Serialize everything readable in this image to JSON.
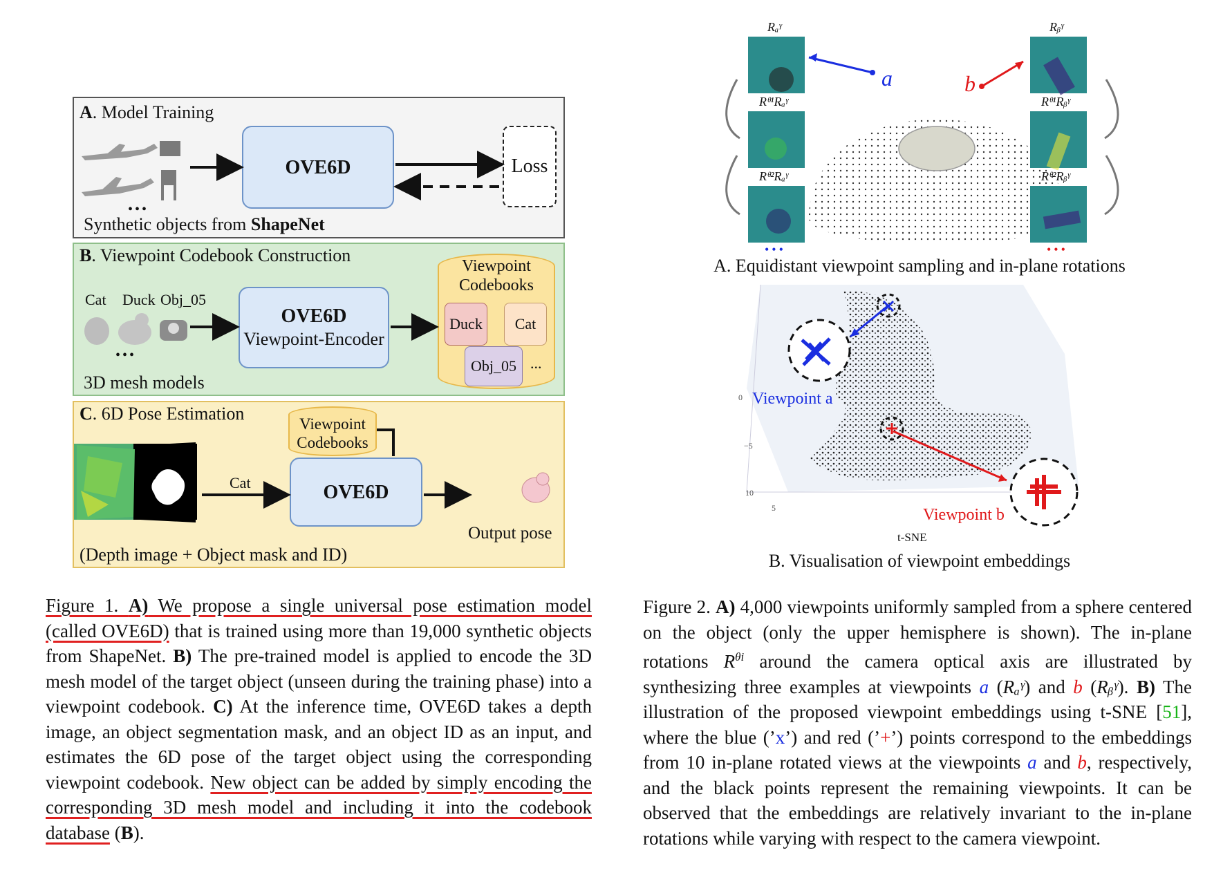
{
  "fig1": {
    "panel_a": {
      "title_letter": "A",
      "title_rest": ". Model Training",
      "model": "OVE6D",
      "loss": "Loss",
      "dots": "•••",
      "source_prefix": "Synthetic objects from ",
      "source_bold": "ShapeNet"
    },
    "panel_b": {
      "title_letter": "B",
      "title_rest": ". Viewpoint Codebook Construction",
      "obj_labels": [
        "Cat",
        "Duck",
        "Obj_05"
      ],
      "model": "OVE6D",
      "model_sub": "Viewpoint-Encoder",
      "db_title": "Viewpoint Codebooks",
      "codebooks": [
        "Duck",
        "Cat",
        "Obj_05"
      ],
      "db_more": "...",
      "dots": "•••",
      "footer": "3D mesh models"
    },
    "panel_c": {
      "title_letter": "C",
      "title_rest": ". 6D Pose Estimation",
      "db_title": "Viewpoint Codebooks",
      "arrow_label": "Cat",
      "model": "OVE6D",
      "output": "Output pose",
      "footer": "(Depth image + Object mask and ID)"
    },
    "caption": {
      "s1": "Figure 1. ",
      "s2": "A)",
      "s3": " We propose a single universal pose estimation model (called OVE6D)",
      "s4": " that is trained using more than 19,000 synthetic objects from ShapeNet. ",
      "s5": "B)",
      "s6": " The pre-trained model is applied to encode the 3D mesh model of the target object (unseen during the training phase) into a viewpoint codebook. ",
      "s7": "C)",
      "s8": " At the inference time, OVE6D takes a depth image, an object segmentation mask, and an object ID as an input, and estimates the 6D pose of the target object using the corresponding viewpoint codebook. ",
      "s9": "New object can be added by simply encoding the corresponding 3D mesh model and including it into the codebook database",
      "s10": " (",
      "s11": "B",
      "s12": ")."
    }
  },
  "fig2": {
    "panel_a": {
      "labels_left": [
        "Rₐᵞ",
        "Rᶿ¹Rₐᵞ",
        "Rᶿ²Rₐᵞ"
      ],
      "labels_right": [
        "Rᵦᵞ",
        "Rᶿ¹Rᵦᵞ",
        "Rᶿ²Rᵦᵞ"
      ],
      "point_a": "a",
      "point_b": "b",
      "dots": "•••",
      "title": "A. Equidistant viewpoint sampling and in-plane rotations"
    },
    "panel_b": {
      "label_a": "Viewpoint a",
      "label_b": "Viewpoint b",
      "axis_ticks": [
        "0",
        "−5",
        "10",
        "5"
      ],
      "axis_label": "t-SNE",
      "title": "B. Visualisation of viewpoint embeddings"
    },
    "caption": {
      "p1": "Figure 2. ",
      "p2": "A)",
      "p3": " 4,000 viewpoints uniformly sampled from a sphere centered on the object (only the upper hemisphere is shown). The in-plane rotations ",
      "p4": "R",
      "p5": "θi",
      "p6": " around the camera optical axis are illustrated by synthesizing three examples at viewpoints ",
      "p7": "a",
      "p8": " (",
      "p9": "Rₐᵞ",
      "p10": ") and ",
      "p11": "b",
      "p12": " (",
      "p13": "Rᵦᵞ",
      "p14": "). ",
      "p15": "B)",
      "p16": " The illustration of the proposed viewpoint embeddings using t-SNE [",
      "p17": "51",
      "p18": "], where the blue (’",
      "p19": "x",
      "p20": "’) and red (’",
      "p21": "+",
      "p22": "’) points correspond to the embeddings from 10 in-plane rotated views at the viewpoints ",
      "p23": "a",
      "p24": " and ",
      "p25": "b",
      "p26": ", respectively, and the black points represent the remaining viewpoints. It can be observed that the embeddings are relatively invariant to the in-plane rotations while varying with respect to the camera viewpoint."
    }
  },
  "colors": {
    "panel_a_bg": "#f4f4f4",
    "panel_b_bg": "#d7ecd4",
    "panel_c_bg": "#fbefc4",
    "model_box": "#dbe8f8",
    "accent_red": "#e0191b",
    "accent_blue": "#1a2ee0",
    "citation_green": "#19b419"
  }
}
